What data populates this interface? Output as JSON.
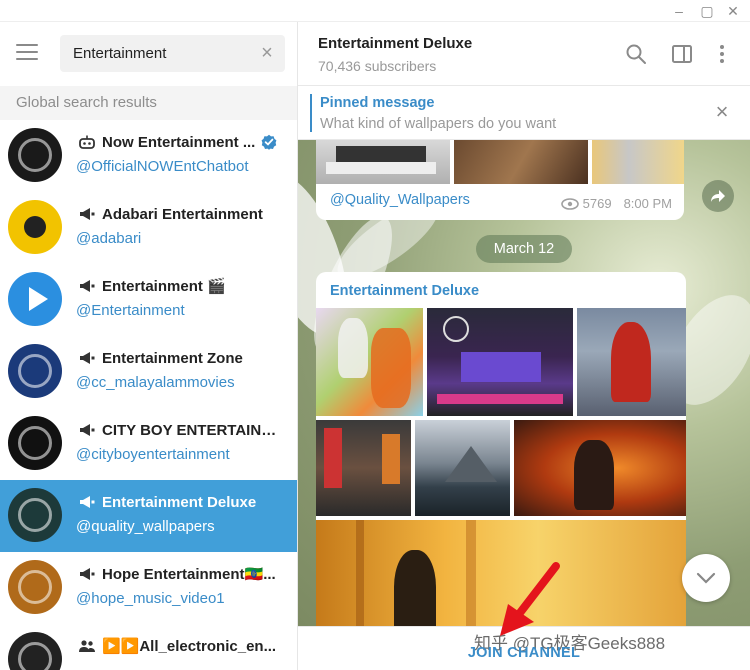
{
  "left": {
    "search": {
      "value": "Entertainment",
      "clear_icon": "close-icon"
    },
    "section_label": "Global search results",
    "results": [
      {
        "title": "Now Entertainment ...",
        "username": "@OfficialNOWEntChatbot",
        "type": "bot",
        "verified": true,
        "avatar_color": "#1a1a1a"
      },
      {
        "title": "Adabari Entertainment",
        "username": "@adabari",
        "type": "channel",
        "verified": false,
        "avatar_color": "#f2c300"
      },
      {
        "title": "Entertainment 🎬",
        "username": "@Entertainment",
        "type": "channel",
        "verified": false,
        "avatar_color": "#2b8fe0"
      },
      {
        "title": "Entertainment Zone",
        "username": "@cc_malayalammovies",
        "type": "channel",
        "verified": false,
        "avatar_color": "#1b3a7a"
      },
      {
        "title": "CITY BOY ENTERTAINME...",
        "username": "@cityboyentertainment",
        "type": "channel",
        "verified": false,
        "avatar_color": "#111111"
      },
      {
        "title": "Entertainment Deluxe",
        "username": "@quality_wallpapers",
        "type": "channel",
        "verified": false,
        "active": true,
        "avatar_color": "#1d3a3a"
      },
      {
        "title": "Hope Entertainment🇪🇹...",
        "username": "@hope_music_video1",
        "type": "channel",
        "verified": false,
        "avatar_color": "#b06a1a"
      },
      {
        "title": "▶️▶️All_electronic_en...",
        "username": "",
        "type": "group",
        "verified": false,
        "avatar_color": "#222222"
      }
    ]
  },
  "chat": {
    "title": "Entertainment Deluxe",
    "subscribers": "70,436 subscribers",
    "pinned": {
      "title": "Pinned message",
      "text": "What kind of wallpapers do you want"
    },
    "prev_message": {
      "signature": "@Quality_Wallpapers",
      "views": "5769",
      "time": "8:00 PM"
    },
    "date_separator": "March 12",
    "album_title": "Entertainment Deluxe",
    "join_label": "JOIN CHANNEL",
    "watermark": "知乎 @TG极客Geeks888"
  },
  "colors": {
    "accent": "#3a8cc8",
    "active_bg": "#419fd9"
  }
}
